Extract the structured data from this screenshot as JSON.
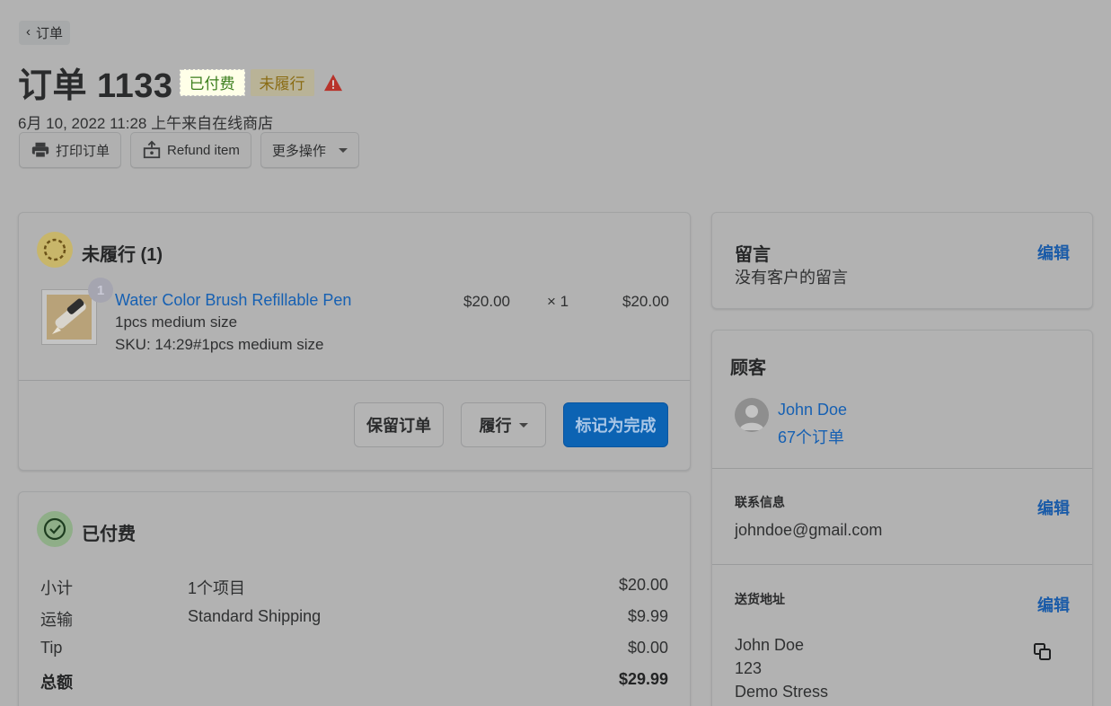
{
  "header": {
    "back_label": "订单",
    "title": "订单 1133",
    "badge_paid": "已付费",
    "badge_unfulfilled": "未履行",
    "subtitle": "6月 10, 2022 11:28 上午来自在线商店"
  },
  "toolbar": {
    "print_label": "打印订单",
    "refund_label": "Refund item",
    "more_label": "更多操作"
  },
  "unfulfilled_card": {
    "title": "未履行 (1)",
    "item": {
      "quantity_badge": "1",
      "name": "Water Color Brush Refillable Pen",
      "variant": "1pcs medium size",
      "sku": "SKU: 14:29#1pcs medium size",
      "unit_price": "$20.00",
      "multiplier": "× 1",
      "line_total": "$20.00"
    },
    "hold_label": "保留订单",
    "fulfill_label": "履行",
    "mark_complete_label": "标记为完成"
  },
  "paid_card": {
    "title": "已付费",
    "rows": [
      {
        "label": "小计",
        "detail": "1个项目",
        "amount": "$20.00"
      },
      {
        "label": "运输",
        "detail": "Standard Shipping",
        "amount": "$9.99"
      },
      {
        "label": "Tip",
        "detail": "",
        "amount": "$0.00"
      },
      {
        "label": "总额",
        "detail": "",
        "amount": "$29.99"
      }
    ]
  },
  "notes_card": {
    "title": "留言",
    "edit_label": "编辑",
    "body": "没有客户的留言"
  },
  "customer_card": {
    "title": "顾客",
    "name": "John Doe",
    "orders": "67个订单",
    "contact_label": "联系信息",
    "contact_edit": "编辑",
    "email": "johndoe@gmail.com",
    "shipping_label": "送货地址",
    "shipping_edit": "编辑",
    "address": [
      "John Doe",
      "123",
      "Demo Stress"
    ]
  },
  "colors": {
    "primary": "#0c63b3",
    "link": "#1461b5",
    "paid_green": "#3a7d1c",
    "warn_red": "#c0302a"
  }
}
